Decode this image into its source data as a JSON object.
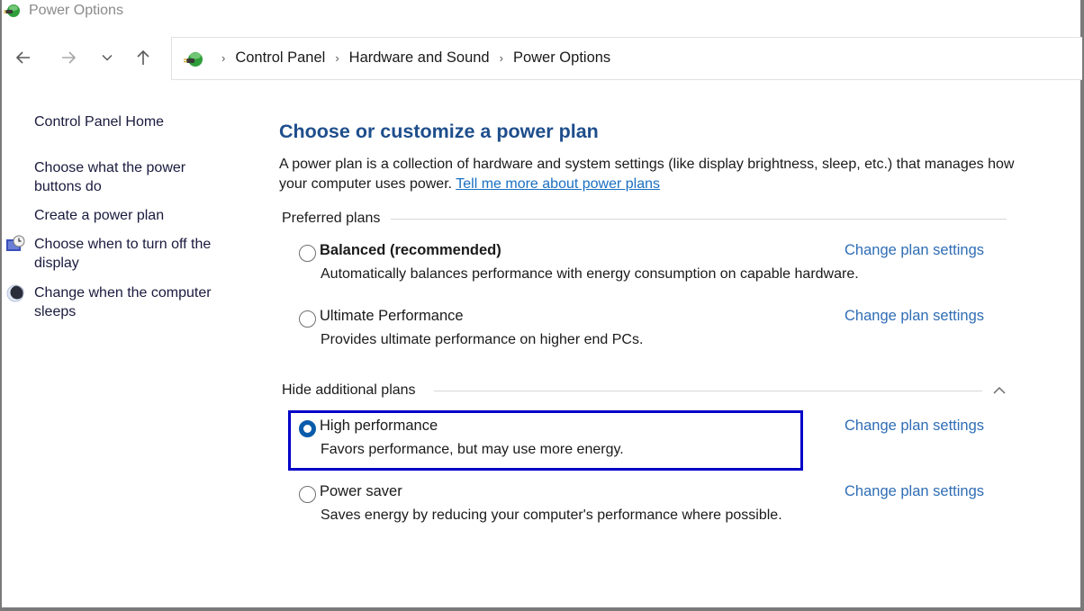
{
  "window": {
    "title": "Power Options",
    "icon": "power-options-icon"
  },
  "nav": {
    "back_icon": "arrow-left-icon",
    "forward_icon": "arrow-right-icon",
    "recent_icon": "chevron-down-icon",
    "up_icon": "arrow-up-icon"
  },
  "address_bar": {
    "icon": "power-options-icon",
    "separator": "›",
    "breadcrumbs": [
      {
        "label": "Control Panel"
      },
      {
        "label": "Hardware and Sound"
      },
      {
        "label": "Power Options"
      }
    ]
  },
  "sidebar": {
    "home": "Control Panel Home",
    "links": [
      {
        "label": "Choose what the power buttons do",
        "icon": null
      },
      {
        "label": "Create a power plan",
        "icon": null
      },
      {
        "label": "Choose when to turn off the display",
        "icon": "display-timer-icon"
      },
      {
        "label": "Change when the computer sleeps",
        "icon": "moon-sleep-icon"
      }
    ]
  },
  "main": {
    "heading": "Choose or customize a power plan",
    "description": "A power plan is a collection of hardware and system settings (like display brightness, sleep, etc.) that manages how your computer uses power.",
    "learn_more_link": "Tell me more about power plans",
    "preferred_label": "Preferred plans",
    "additional_label": "Hide additional plans",
    "change_link": "Change plan settings",
    "plans": [
      {
        "name": "Balanced (recommended)",
        "description": "Automatically balances performance with energy consumption on capable hardware.",
        "selected": false,
        "bold": true
      },
      {
        "name": "Ultimate Performance",
        "description": "Provides ultimate performance on higher end PCs.",
        "selected": false,
        "bold": false
      },
      {
        "name": "High performance",
        "description": "Favors performance, but may use more energy.",
        "selected": true,
        "bold": false
      },
      {
        "name": "Power saver",
        "description": "Saves energy by reducing your computer's performance where possible.",
        "selected": false,
        "bold": false
      }
    ],
    "highlight_color": "#0000c8",
    "link_color": "#2f6db5",
    "heading_color": "#1e4e8c"
  }
}
